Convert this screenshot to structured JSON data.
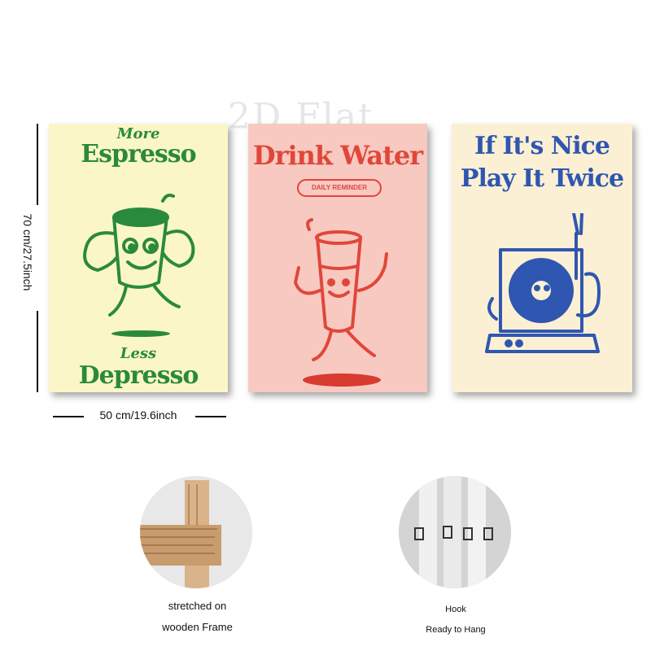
{
  "watermark": "2D Flat",
  "posters": [
    {
      "line1": "More",
      "line2": "Espresso",
      "line3": "Less",
      "line4": "Depresso",
      "color": "#2a8a3c"
    },
    {
      "title": "Drink Water",
      "subtitle": "DAILY REMINDER",
      "color": "#e0473a"
    },
    {
      "line1": "If It's Nice",
      "line2": "Play It Twice",
      "color": "#2f56b0"
    }
  ],
  "dimensions": {
    "height": "70 cm/27.5inch",
    "width": "50 cm/19.6inch"
  },
  "features": [
    {
      "line1": "stretched on",
      "line2": "wooden Frame"
    },
    {
      "line1": "Hook",
      "line2": "Ready to Hang"
    }
  ]
}
